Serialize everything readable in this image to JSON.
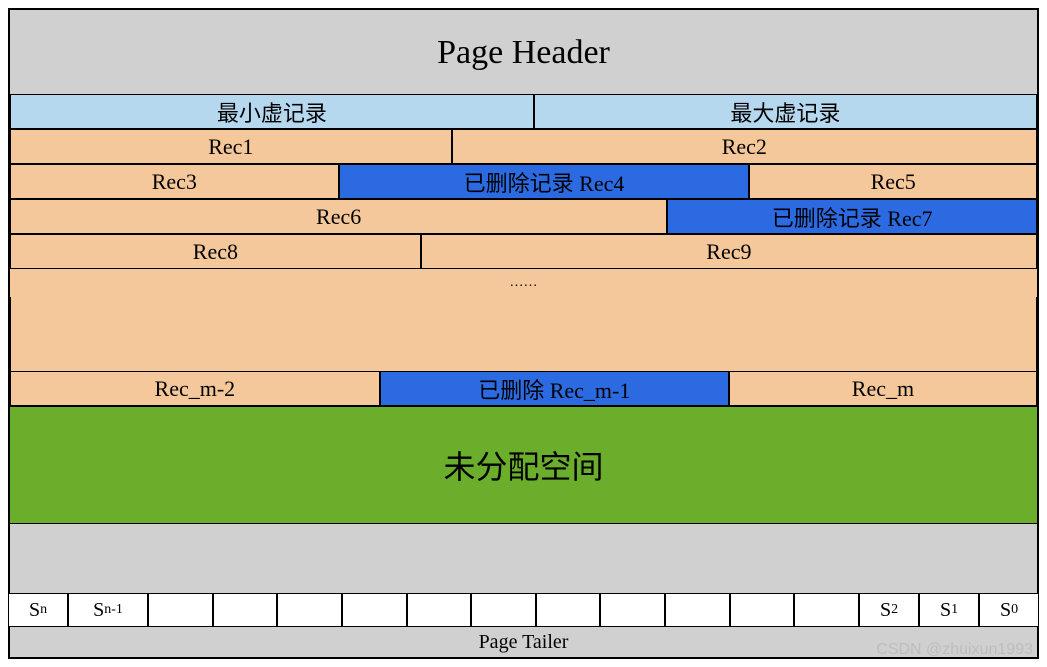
{
  "header": {
    "title": "Page Header"
  },
  "virtual": {
    "min": "最小虚记录",
    "max": "最大虚记录"
  },
  "row1": {
    "rec1": "Rec1",
    "rec2": "Rec2"
  },
  "row2": {
    "rec3": "Rec3",
    "rec4_deleted": "已删除记录 Rec4",
    "rec5": "Rec5"
  },
  "row3": {
    "rec6": "Rec6",
    "rec7_deleted": "已删除记录 Rec7"
  },
  "row4": {
    "rec8": "Rec8",
    "rec9": "Rec9"
  },
  "ellipsis": "……",
  "row5": {
    "rec_m_2": "Rec_m-2",
    "rec_m_1_deleted": "已删除 Rec_m-1",
    "rec_m": "Rec_m"
  },
  "unallocated": "未分配空间",
  "slots": {
    "sn": "S",
    "sn_sub": "n",
    "sn1": "S",
    "sn1_sub": "n-1",
    "s2": "S",
    "s2_sub": "2",
    "s1": "S",
    "s1_sub": "1",
    "s0": "S",
    "s0_sub": "0"
  },
  "tailer": "Page Tailer",
  "watermark": "CSDN @zhuixun1993"
}
